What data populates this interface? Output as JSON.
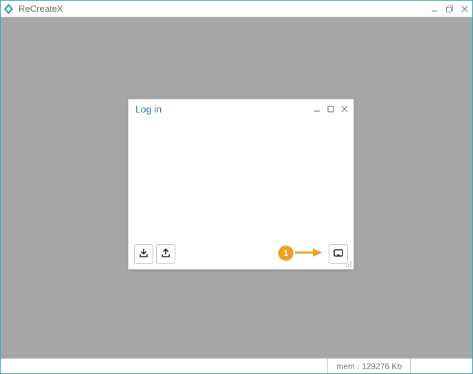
{
  "app": {
    "title": "ReCreateX"
  },
  "dialog": {
    "title": "Log in"
  },
  "icons": {
    "download": "download-icon",
    "upload": "upload-icon",
    "popout": "popout-icon"
  },
  "callout": {
    "number": "1"
  },
  "status": {
    "mem": "mem : 129276 Kb"
  }
}
